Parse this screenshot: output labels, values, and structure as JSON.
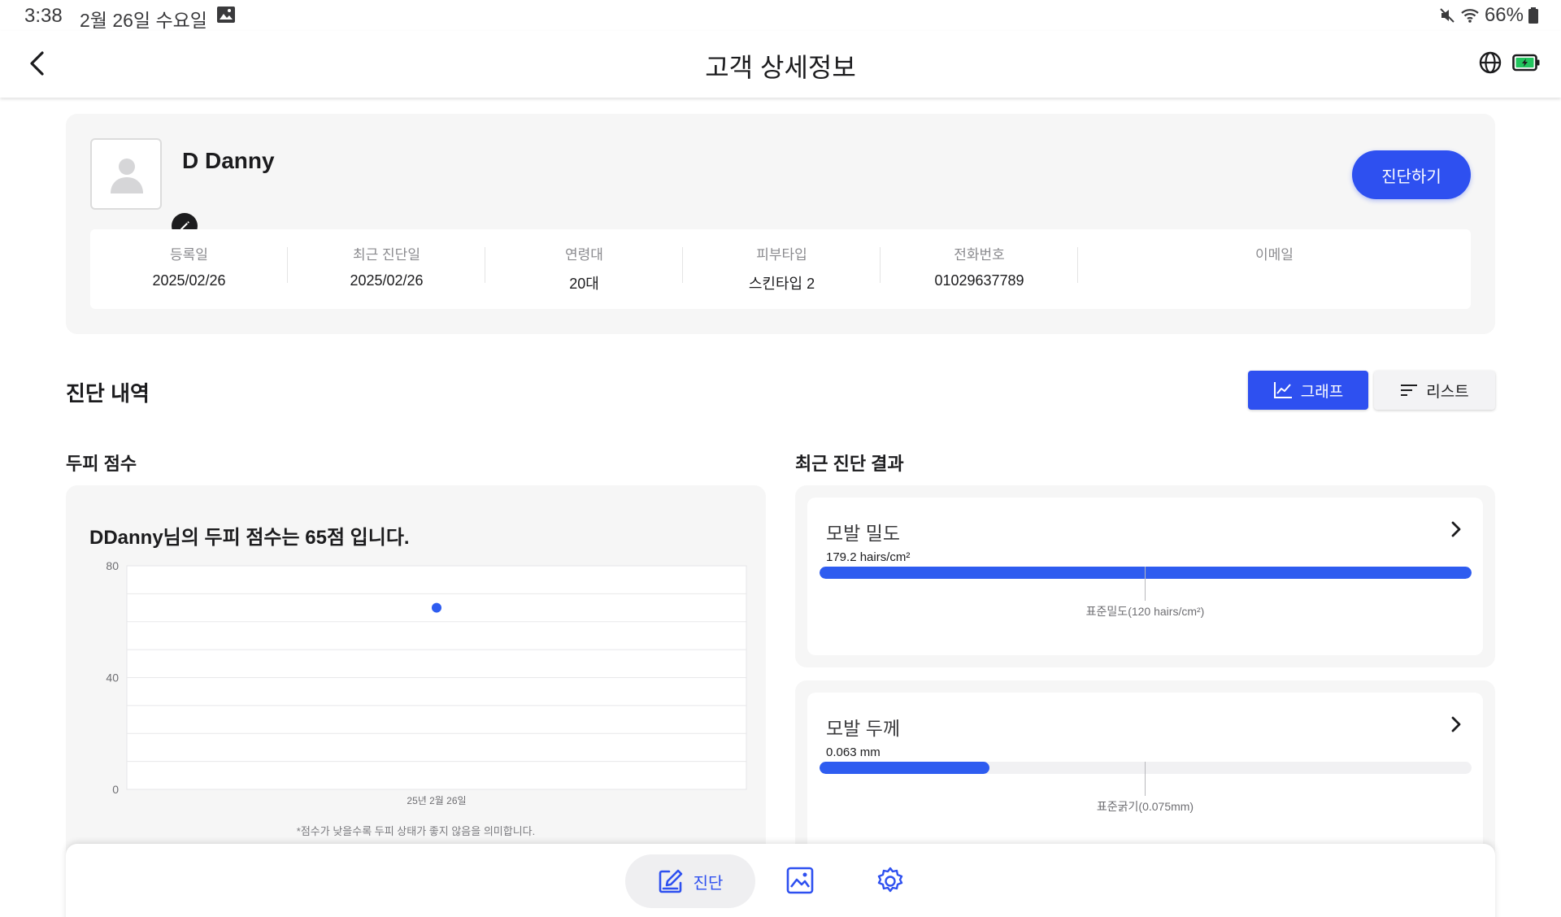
{
  "status_bar": {
    "time": "3:38",
    "date": "2월 26일 수요일",
    "battery": "66%"
  },
  "header": {
    "title": "고객 상세정보"
  },
  "profile": {
    "name": "D Danny",
    "diagnose_button": "진단하기",
    "fields": [
      {
        "label": "등록일",
        "value": "2025/02/26"
      },
      {
        "label": "최근 진단일",
        "value": "2025/02/26"
      },
      {
        "label": "연령대",
        "value": "20대"
      },
      {
        "label": "피부타입",
        "value": "스킨타입 2"
      },
      {
        "label": "전화번호",
        "value": "01029637789"
      },
      {
        "label": "이메일",
        "value": ""
      }
    ]
  },
  "history": {
    "title": "진단 내역",
    "graph_label": "그래프",
    "list_label": "리스트"
  },
  "scalp_score": {
    "section_title": "두피 점수",
    "heading": "DDanny님의 두피 점수는 65점 입니다.",
    "note": "*점수가 낮을수록 두피 상태가 좋지 않음을 의미합니다."
  },
  "chart_data": {
    "type": "scatter",
    "categories": [
      "25년 2월 26일"
    ],
    "values": [
      65
    ],
    "ylim": [
      0,
      80
    ],
    "yticks": [
      0,
      40,
      80
    ],
    "grid": true,
    "point_color": "#2e5cf0"
  },
  "recent_results": {
    "section_title": "최근 진단 결과",
    "items": [
      {
        "title": "모발 밀도",
        "value": "179.2 hairs/cm²",
        "fill": 1.0,
        "standard": "표준밀도(120 hairs/cm²)"
      },
      {
        "title": "모발 두께",
        "value": "0.063 mm",
        "fill": 0.26,
        "standard": "표준굵기(0.075mm)"
      }
    ]
  },
  "bottom_nav": {
    "diagnose_label": "진단",
    "active_color": "#2e50f0"
  }
}
